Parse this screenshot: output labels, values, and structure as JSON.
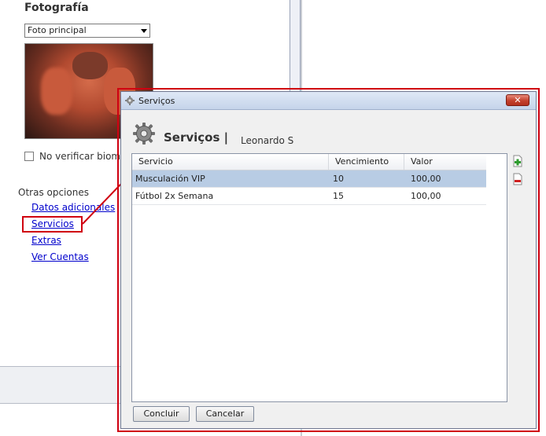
{
  "background": {
    "title": "Fotografía",
    "photo_select": "Foto principal",
    "bio_checkbox_label": "No verificar biom",
    "other_options_title": "Otras opciones",
    "links": [
      "Datos adicionales",
      "Servicios",
      "Extras",
      "Ver Cuentas"
    ]
  },
  "modal": {
    "window_title": "Serviços",
    "heading": "Serviços |",
    "subject": "Leonardo S",
    "columns": [
      "Servicio",
      "Vencimiento",
      "Valor"
    ],
    "rows": [
      {
        "servicio": "Musculación VIP",
        "vencimiento": "10",
        "valor": "100,00",
        "selected": true
      },
      {
        "servicio": "Fútbol 2x Semana",
        "vencimiento": "15",
        "valor": "100,00",
        "selected": false
      }
    ],
    "buttons": {
      "ok": "Concluir",
      "cancel": "Cancelar"
    },
    "icons": {
      "add": "add-document-icon",
      "remove": "remove-document-icon",
      "close": "close-icon",
      "title": "gear-icon"
    }
  },
  "colors": {
    "highlight": "#d00010",
    "selection": "#b8cce4",
    "link": "#0000cc"
  }
}
